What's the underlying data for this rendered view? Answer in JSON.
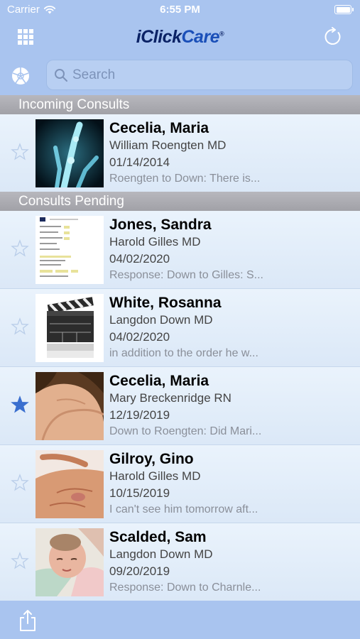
{
  "status_bar": {
    "carrier": "Carrier",
    "time": "6:55 PM"
  },
  "nav": {
    "logo_i": "i",
    "logo_click": "Click",
    "logo_care": "Care",
    "logo_reg": "®"
  },
  "search": {
    "placeholder": "Search",
    "value": ""
  },
  "sections": [
    {
      "title": "Incoming Consults",
      "rows": [
        {
          "name": "Cecelia, Maria",
          "author": "William Roengten MD",
          "date": "01/14/2014",
          "preview": "Roengten to Down: There is...",
          "starred": false,
          "thumb": "xray-hand-image"
        }
      ]
    },
    {
      "title": "Consults Pending",
      "rows": [
        {
          "name": "Jones, Sandra",
          "author": "Harold Gilles MD",
          "date": "04/02/2020",
          "preview": "Response: Down to Gilles: S...",
          "starred": false,
          "thumb": "document-form-image"
        },
        {
          "name": "White, Rosanna",
          "author": "Langdon Down MD",
          "date": "04/02/2020",
          "preview": "in addition to the order he w...",
          "starred": false,
          "thumb": "clapperboard-video-image"
        },
        {
          "name": "Cecelia, Maria",
          "author": "Mary Breckenridge RN",
          "date": "12/19/2019",
          "preview": "Down to Roengten: Did Mari...",
          "starred": true,
          "thumb": "hand-photo-image"
        },
        {
          "name": "Gilroy, Gino",
          "author": "Harold Gilles MD",
          "date": "10/15/2019",
          "preview": "I can't see him tomorrow aft...",
          "starred": false,
          "thumb": "hand-photo-image"
        },
        {
          "name": "Scalded, Sam",
          "author": "Langdon Down MD",
          "date": "09/20/2019",
          "preview": "Response: Down to Charnle...",
          "starred": false,
          "thumb": "baby-photo-image"
        }
      ]
    }
  ],
  "colors": {
    "bar": "#a9c4ef",
    "logo": "#0b2265",
    "star_filled": "#3a6fcf",
    "star_outline": "#b9cde9"
  }
}
